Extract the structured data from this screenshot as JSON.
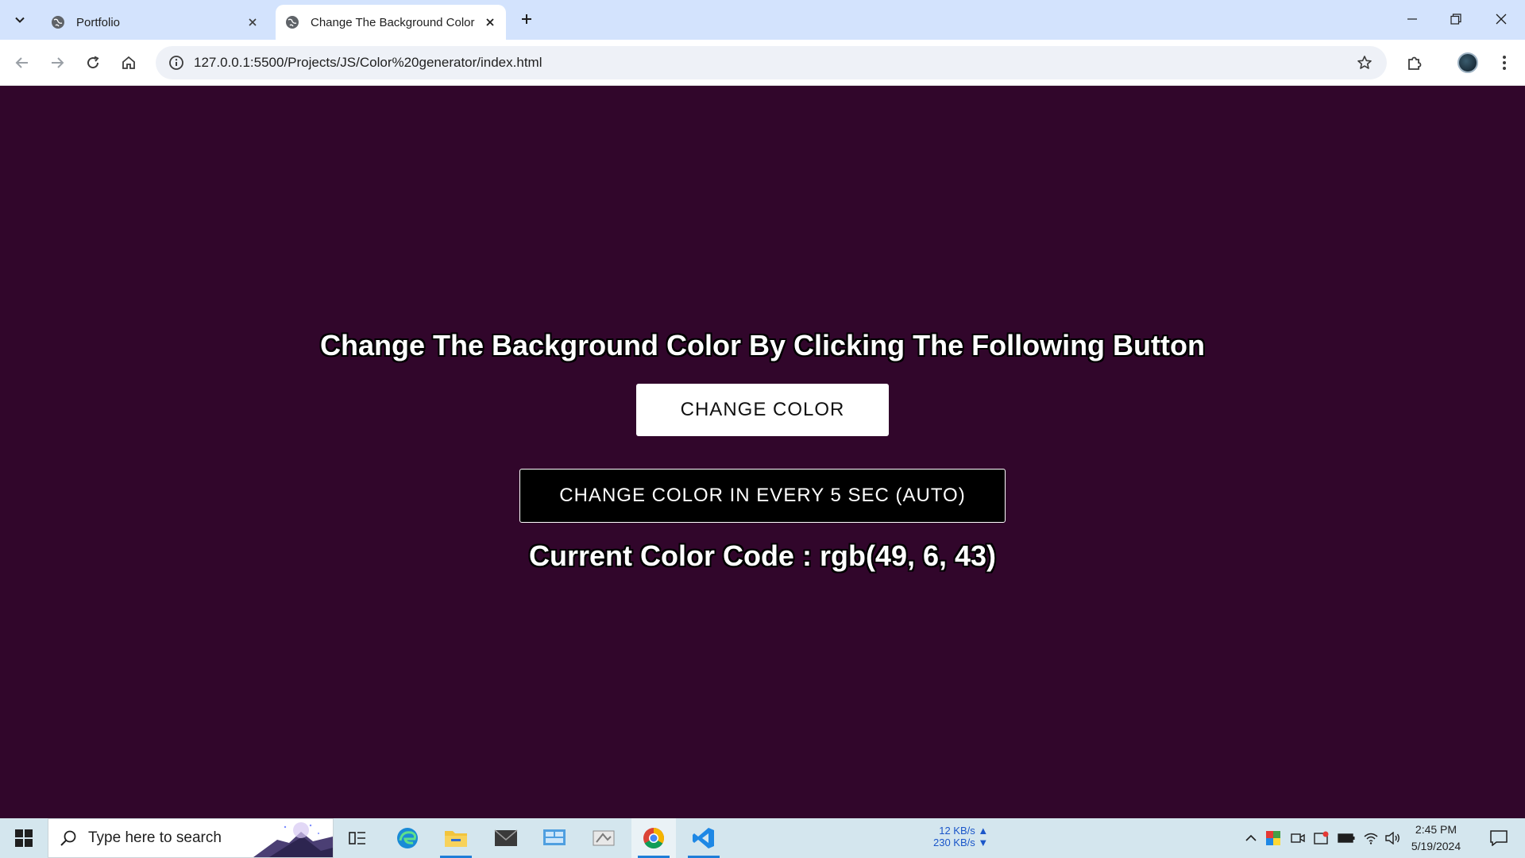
{
  "browser": {
    "tabs": [
      {
        "title": "Portfolio",
        "active": false
      },
      {
        "title": "Change The Background Color",
        "active": true
      }
    ],
    "url": "127.0.0.1:5500/Projects/JS/Color%20generator/index.html"
  },
  "page": {
    "background_color": "#31062b",
    "heading": "Change The Background Color By Clicking The Following Button",
    "change_button_label": "CHANGE COLOR",
    "auto_button_label": "CHANGE COLOR IN EVERY 5 SEC (AUTO)",
    "color_code_text": "Current Color Code : rgb(49, 6, 43)"
  },
  "taskbar": {
    "search_placeholder": "Type here to search",
    "net_up": "12 KB/s",
    "net_down": "230 KB/s",
    "up_arrow": "▲",
    "down_arrow": "▼",
    "time": "2:45 PM",
    "date": "5/19/2024",
    "apps": [
      "task-view",
      "edge",
      "file-explorer",
      "mail",
      "control-panel",
      "paint",
      "chrome",
      "vscode"
    ]
  },
  "colors": {
    "tabstrip": "#d3e3fd",
    "page_bg": "#31062b",
    "taskbar": "#d4e6ee",
    "accent": "#1e7ed8"
  }
}
